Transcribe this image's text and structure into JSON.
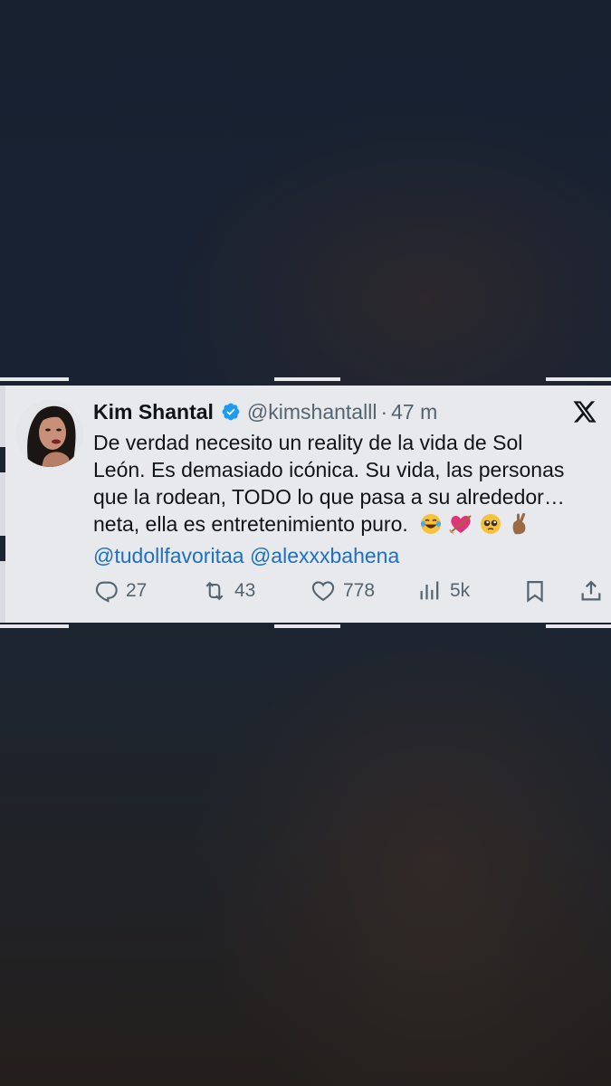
{
  "tweet": {
    "author_name": "Kim Shantal",
    "handle": "@kimshantalll",
    "separator": "·",
    "time": "47 m",
    "lines": [
      "De verdad necesito un reality de la vida de Sol",
      "León. Es demasiado icónica. Su vida, las personas",
      "que la rodean, TODO lo que pasa a su alrededor…",
      "neta, ella es entretenimiento puro."
    ],
    "emojis": [
      "face-with-tears-of-joy",
      "heart-with-arrow",
      "pleading-face",
      "hand-with-index-finger-and-thumb-crossed"
    ],
    "mentions": [
      "@tudollfavoritaa",
      "@alexxxbahena"
    ],
    "metrics": {
      "replies": "27",
      "reposts": "43",
      "likes": "778",
      "views": "5k"
    },
    "icons": [
      "verified-badge-icon",
      "x-logo-icon",
      "reply-icon",
      "repost-icon",
      "like-icon",
      "views-icon",
      "bookmark-icon",
      "share-icon"
    ]
  },
  "colors": {
    "card_background": "#e8e9ec",
    "text_primary": "#0f1419",
    "text_secondary": "#536471",
    "mention": "#1d6fc2",
    "verified": "#1d9bf0"
  }
}
